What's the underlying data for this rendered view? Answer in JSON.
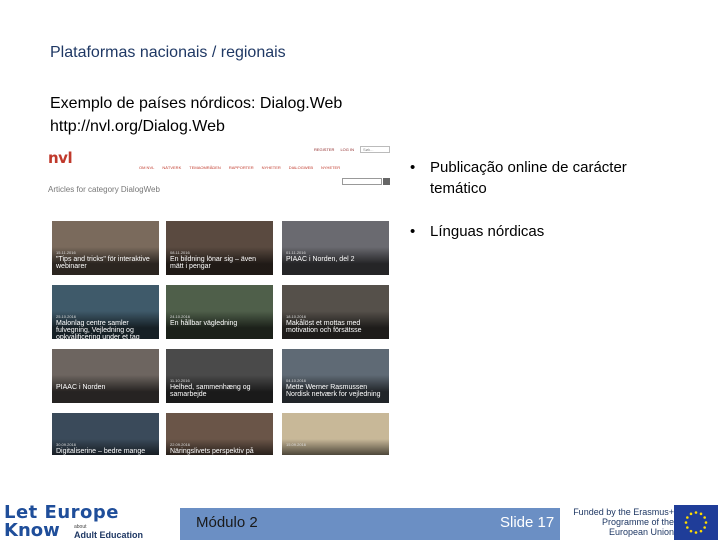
{
  "slide": {
    "title": "Plataformas nacionais / regionais",
    "subtitle": "Exemplo de países nórdicos: Dialog.Web",
    "url": "http://nvl.org/Dialog.Web"
  },
  "screenshot": {
    "logo_text": "nvl",
    "topbar_links": [
      "REGISTER",
      "LOG IN"
    ],
    "search_placeholder": "Søk...",
    "menu_items": [
      "Om NVL",
      "Nätverk",
      "Temaområden",
      "Rapporter",
      "Nyheter",
      "Dialogweb",
      "Nyheter"
    ],
    "category_title": "Articles for category DialogWeb",
    "cards": [
      {
        "date": "15.11.2016",
        "title": "\"Tips and tricks\" för interaktive webinarer",
        "bg": "#7a6a5c"
      },
      {
        "date": "08.11.2016",
        "title": "En bildning lönar sig – även mätt i pengar",
        "bg": "#5a4a40"
      },
      {
        "date": "01.11.2016",
        "title": "PIAAC i Norden, del 2",
        "bg": "#6a6a70"
      },
      {
        "date": "25.10.2016",
        "title": "Malonlag centre samler fulvegning, Vejledning og opkvalificering under et tag",
        "bg": "#3f5a6a"
      },
      {
        "date": "24.10.2016",
        "title": "En hållbar vägledning",
        "bg": "#4f5f4a"
      },
      {
        "date": "18.10.2016",
        "title": "Makålöst et mottas med motivation och försätsse",
        "bg": "#55504a"
      },
      {
        "date": "",
        "title": "PIAAC i Norden",
        "bg": "#6d6560"
      },
      {
        "date": "11.10.2016",
        "title": "Helhed, sammenhæng og samarbejde",
        "bg": "#4a4a4a"
      },
      {
        "date": "04.10.2016",
        "title": "Mette Werner Rasmussen Nordisk netværk for vejledning",
        "bg": "#5f6a75"
      },
      {
        "date": "30.09.2016",
        "title": "Digitaliserine – bedre mange",
        "bg": "#3a4a5a"
      },
      {
        "date": "22.09.2016",
        "title": "Näringslivets perspektiv på",
        "bg": "#6a5548"
      },
      {
        "date": "15.09.2016",
        "title": "",
        "bg": "#c8b898"
      }
    ]
  },
  "bullets": [
    "Publicação online de carácter temático",
    "Línguas nórdicas"
  ],
  "bullet_symbol": "•",
  "footer": {
    "module": "Módulo 2",
    "slide_number": "Slide 17",
    "logo_line1": "Let Europe",
    "logo_line2": "Know",
    "logo_about": "about",
    "logo_adult": "Adult Education",
    "eu_text": "Funded by the Erasmus+ Programme of the European Union"
  },
  "colors": {
    "title": "#1f3864",
    "footer_bar": "#6b8fc4",
    "nvl_red": "#c0392b",
    "eu_blue": "#1f3d99",
    "eu_star": "#ffdd00"
  }
}
